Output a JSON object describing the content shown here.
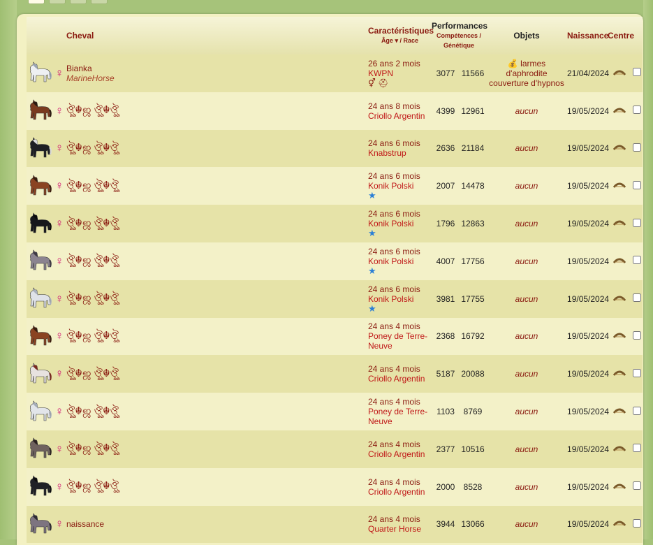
{
  "headers": {
    "cheval": "Cheval",
    "carac": "Caractéristiques",
    "age": "Âge",
    "sep": "/",
    "race": "Race",
    "perf": "Performances",
    "competences": "Compétences",
    "genetique": "Génétique",
    "objets": "Objets",
    "naissance": "Naissance",
    "centre": "Centre"
  },
  "gender_symbol": "♀",
  "rows": [
    {
      "coat": "#eef0f3",
      "mane": "#9aa4b2",
      "name": "Bianka",
      "owner": "MarineHorse",
      "age": "26 ans 2 mois",
      "race": "KWPN",
      "icons": "⚥ ⛑",
      "comp": "3077",
      "gen": "11566",
      "obj": "💰 larmes d'aphrodite couverture d'hypnos",
      "date": "21/04/2024"
    },
    {
      "coat": "#7a3b1f",
      "mane": "#2a1a10",
      "name": "ঔৣ☬ஜ ঔৣ☬ঔৣ",
      "owner": "",
      "age": "24 ans 8 mois",
      "race": "Criollo Argentin",
      "icons": "",
      "comp": "4399",
      "gen": "12961",
      "obj": "aucun",
      "date": "19/05/2024"
    },
    {
      "coat": "#1e1f24",
      "mane": "#dcdcdc",
      "name": "ঔৣ☬ஜ ঔৣ☬ঔৣ",
      "owner": "",
      "age": "24 ans 6 mois",
      "race": "Knabstrup",
      "icons": "",
      "comp": "2636",
      "gen": "21184",
      "obj": "aucun",
      "date": "19/05/2024"
    },
    {
      "coat": "#8a4322",
      "mane": "#3a1d0f",
      "name": "ঔৣ☬ஜ ঔৣ☬ঔৣ",
      "owner": "",
      "age": "24 ans 6 mois",
      "race": "Konik Polski",
      "icons": "★",
      "comp": "2007",
      "gen": "14478",
      "obj": "aucun",
      "date": "19/05/2024"
    },
    {
      "coat": "#16171b",
      "mane": "#0a0a0a",
      "name": "ঔৣ☬ஜ ঔৣ☬ঔৣ",
      "owner": "",
      "age": "24 ans 6 mois",
      "race": "Konik Polski",
      "icons": "★",
      "comp": "1796",
      "gen": "12863",
      "obj": "aucun",
      "date": "19/05/2024"
    },
    {
      "coat": "#8b8490",
      "mane": "#3e3a45",
      "name": "ঔৣ☬ஜ ঔৣ☬ঔৣ",
      "owner": "",
      "age": "24 ans 6 mois",
      "race": "Konik Polski",
      "icons": "★",
      "comp": "4007",
      "gen": "17756",
      "obj": "aucun",
      "date": "19/05/2024"
    },
    {
      "coat": "#dfe2e8",
      "mane": "#a9b0bc",
      "name": "ঔৣ☬ஜ ঔৣ☬ঔৣ",
      "owner": "",
      "age": "24 ans 6 mois",
      "race": "Konik Polski",
      "icons": "★",
      "comp": "3981",
      "gen": "17755",
      "obj": "aucun",
      "date": "19/05/2024"
    },
    {
      "coat": "#8a4322",
      "mane": "#3a1d0f",
      "name": "ঔৣ☬ஜ ঔৣ☬ঔৣ",
      "owner": "",
      "age": "24 ans 4 mois",
      "race": "Poney de Terre-Neuve",
      "icons": "",
      "comp": "2368",
      "gen": "16792",
      "obj": "aucun",
      "date": "19/05/2024"
    },
    {
      "coat": "#e7e2e0",
      "mane": "#7a2a20",
      "name": "ঔৣ☬ஜ ঔৣ☬ঔৣ",
      "owner": "",
      "age": "24 ans 4 mois",
      "race": "Criollo Argentin",
      "icons": "",
      "comp": "5187",
      "gen": "20088",
      "obj": "aucun",
      "date": "19/05/2024"
    },
    {
      "coat": "#e2e5ea",
      "mane": "#a4acb8",
      "name": "ঔৣ☬ஜ ঔৣ☬ঔৣ",
      "owner": "",
      "age": "24 ans 4 mois",
      "race": "Poney de Terre-Neuve",
      "icons": "",
      "comp": "1103",
      "gen": "8769",
      "obj": "aucun",
      "date": "19/05/2024"
    },
    {
      "coat": "#6f625e",
      "mane": "#2b2220",
      "name": "ঔৣ☬ஜ ঔৣ☬ঔৣ",
      "owner": "",
      "age": "24 ans 4 mois",
      "race": "Criollo Argentin",
      "icons": "",
      "comp": "2377",
      "gen": "10516",
      "obj": "aucun",
      "date": "19/05/2024"
    },
    {
      "coat": "#202126",
      "mane": "#0d0d0f",
      "name": "ঔৣ☬ஜ ঔৣ☬ঔৣ",
      "owner": "",
      "age": "24 ans 4 mois",
      "race": "Criollo Argentin",
      "icons": "",
      "comp": "2000",
      "gen": "8528",
      "obj": "aucun",
      "date": "19/05/2024"
    },
    {
      "coat": "#7d7480",
      "mane": "#2e2a33",
      "name": "naissance",
      "owner": "",
      "age": "24 ans 4 mois",
      "race": "Quarter Horse",
      "icons": "",
      "comp": "3944",
      "gen": "13066",
      "obj": "aucun",
      "date": "19/05/2024"
    }
  ]
}
